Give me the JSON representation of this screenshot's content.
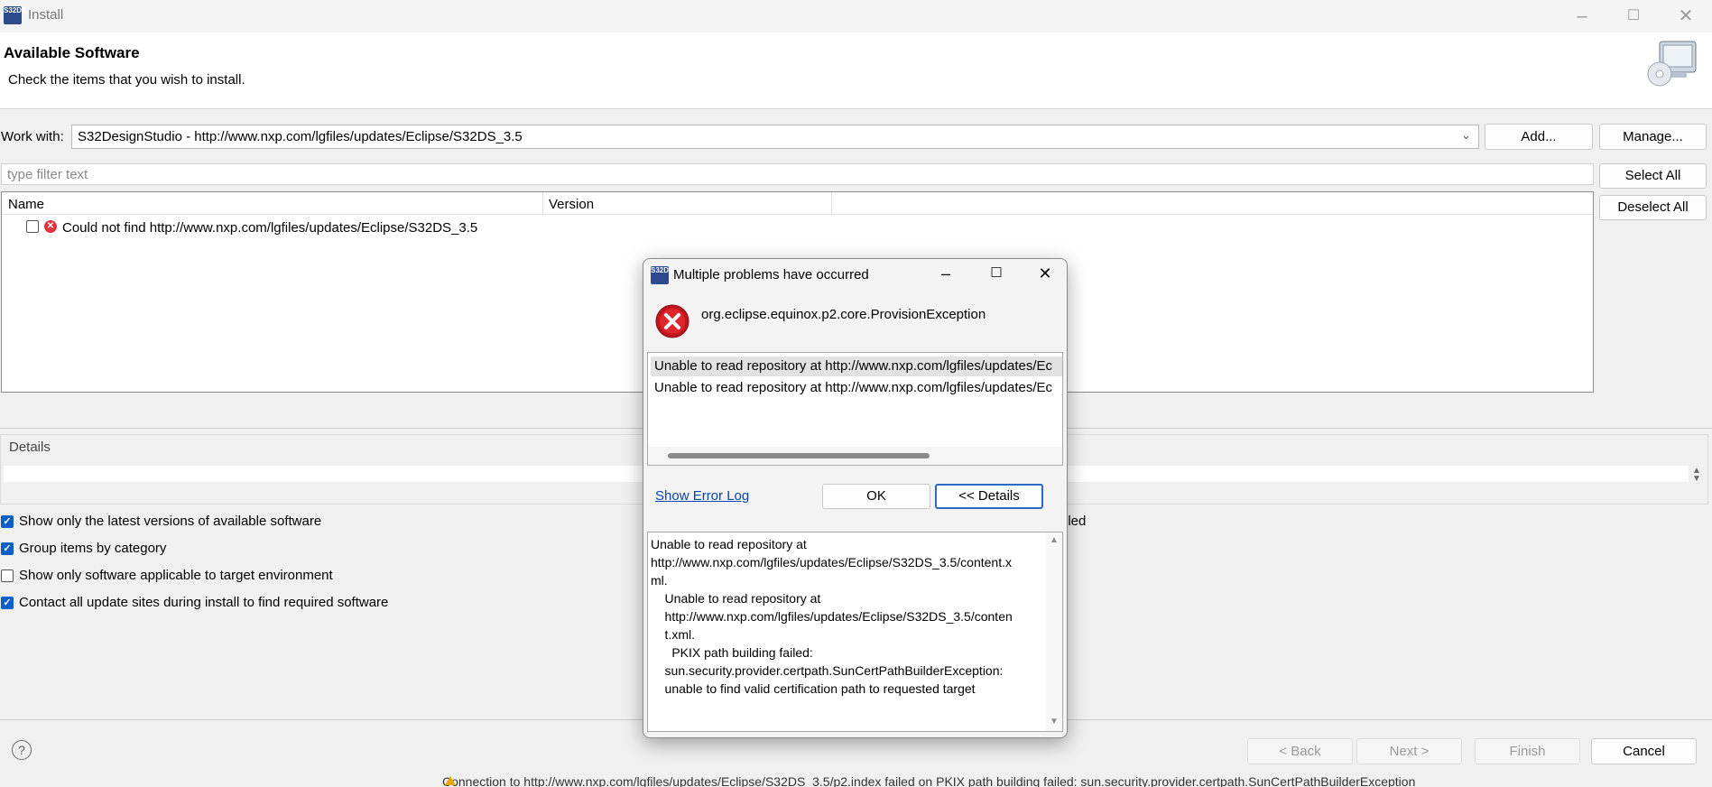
{
  "window": {
    "title": "Install",
    "app_icon_text": "S32DS"
  },
  "header": {
    "title": "Available Software",
    "subtitle": "Check the items that you wish to install."
  },
  "work_with": {
    "label": "Work with:",
    "value": "S32DesignStudio - http://www.nxp.com/lgfiles/updates/Eclipse/S32DS_3.5",
    "add_label": "Add...",
    "manage_label": "Manage..."
  },
  "filter": {
    "placeholder": "type filter text"
  },
  "side_buttons": {
    "select_all": "Select All",
    "deselect_all": "Deselect All"
  },
  "table": {
    "columns": [
      "Name",
      "Version"
    ],
    "rows": [
      {
        "name": "Could not find http://www.nxp.com/lgfiles/updates/Eclipse/S32DS_3.5",
        "version": ""
      }
    ]
  },
  "details": {
    "label": "Details"
  },
  "options": [
    {
      "label": "Show only the latest versions of available software",
      "checked": true
    },
    {
      "label": "Group items by category",
      "checked": true
    },
    {
      "label": "Show only software applicable to target environment",
      "checked": false
    },
    {
      "label": "Contact all update sites during install to find required software",
      "checked": true
    }
  ],
  "right_partial": "lled",
  "footer": {
    "back": "< Back",
    "next": "Next >",
    "finish": "Finish",
    "cancel": "Cancel"
  },
  "background_status": "Connection to http://www.nxp.com/lgfiles/updates/Eclipse/S32DS_3.5/p2.index failed on PKIX path building failed: sun.security.provider.certpath.SunCertPathBuilderException",
  "dialog": {
    "title": "Multiple problems have occurred",
    "exception": "org.eclipse.equinox.p2.core.ProvisionException",
    "problems": [
      "Unable to read repository at http://www.nxp.com/lgfiles/updates/Ec",
      "Unable to read repository at http://www.nxp.com/lgfiles/updates/Ec"
    ],
    "show_error_log": "Show Error Log",
    "ok": "OK",
    "details_toggle": "<< Details",
    "details_text": "Unable to read repository at\nhttp://www.nxp.com/lgfiles/updates/Eclipse/S32DS_3.5/content.x\nml.\n    Unable to read repository at\n    http://www.nxp.com/lgfiles/updates/Eclipse/S32DS_3.5/conten\n    t.xml.\n      PKIX path building failed:\n    sun.security.provider.certpath.SunCertPathBuilderException:\n    unable to find valid certification path to requested target"
  }
}
